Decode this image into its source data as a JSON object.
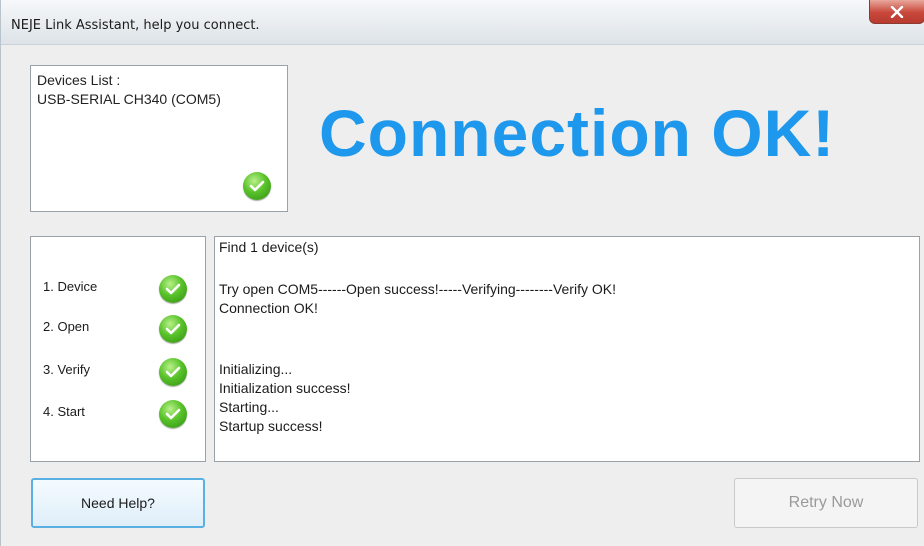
{
  "window": {
    "title": "NEJE Link Assistant, help you connect."
  },
  "devices": {
    "label": "Devices List :",
    "item": "USB-SERIAL CH340 (COM5)",
    "status_icon": "check-icon"
  },
  "status": {
    "headline": "Connection OK!",
    "color": "#1e98ec"
  },
  "steps": [
    {
      "label": "1. Device",
      "icon": "check-icon"
    },
    {
      "label": "2. Open",
      "icon": "check-icon"
    },
    {
      "label": "3. Verify",
      "icon": "check-icon"
    },
    {
      "label": "4. Start",
      "icon": "check-icon"
    }
  ],
  "log": {
    "lines": [
      "Find 1 device(s)",
      "Try open COM5------Open success!-----Verifying--------Verify OK!",
      "Connection OK!",
      "Initializing...",
      "Initialization success!",
      "Starting...",
      "Startup success!"
    ]
  },
  "buttons": {
    "help": "Need Help?",
    "retry": "Retry Now"
  }
}
